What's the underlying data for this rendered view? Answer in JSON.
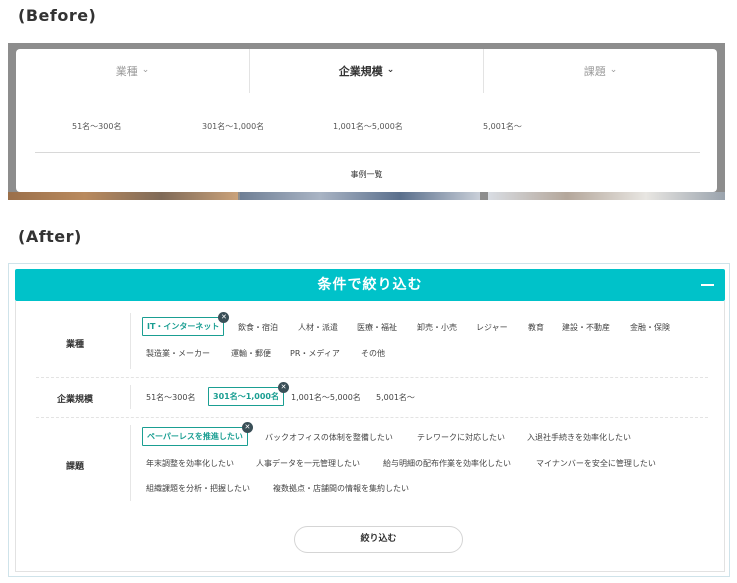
{
  "before": {
    "heading": "(Before)",
    "tabs": [
      {
        "label": "業種",
        "chevron": "chevron-down-icon"
      },
      {
        "label": "企業規模",
        "chevron": "chevron-down-icon"
      },
      {
        "label": "課題",
        "chevron": "chevron-down-icon"
      }
    ],
    "sizes": [
      "51名～300名",
      "301名～1,000名",
      "1,001名～5,000名",
      "5,001名～"
    ],
    "list_link": "事例一覧",
    "colors": {
      "frame": "#8d8d8d",
      "card": "#ffffff"
    }
  },
  "after": {
    "heading": "(After)",
    "header_title": "条件で絞り込む",
    "collapse_icon": "minus-icon",
    "filters": {
      "industry": {
        "label": "業種",
        "options": [
          "IT・インターネット",
          "飲食・宿泊",
          "人材・派遣",
          "医療・福祉",
          "卸売・小売",
          "レジャー",
          "教育",
          "建設・不動産",
          "金融・保険",
          "製造業・メーカー",
          "運輸・郵便",
          "PR・メディア",
          "その他"
        ],
        "selected": "IT・インターネット"
      },
      "company_size": {
        "label": "企業規模",
        "options": [
          "51名～300名",
          "301名～1,000名",
          "1,001名～5,000名",
          "5,001名～"
        ],
        "selected": "301名～1,000名"
      },
      "issue": {
        "label": "課題",
        "options": [
          "ペーパーレスを推進したい",
          "バックオフィスの体制を整備したい",
          "テレワークに対応したい",
          "入退社手続きを効率化したい",
          "年末調整を効率化したい",
          "人事データを一元管理したい",
          "給与明細の配布作業を効率化したい",
          "マイナンバーを安全に管理したい",
          "組織課題を分析・把握したい",
          "複数拠点・店舗間の情報を集約したい"
        ],
        "selected": "ペーパーレスを推進したい"
      }
    },
    "remove_icon": "close-icon",
    "submit_label": "絞り込む",
    "colors": {
      "accent": "#00c2c9",
      "selected_chip": "#1a9e92",
      "remove_badge": "#3a4f57"
    }
  }
}
